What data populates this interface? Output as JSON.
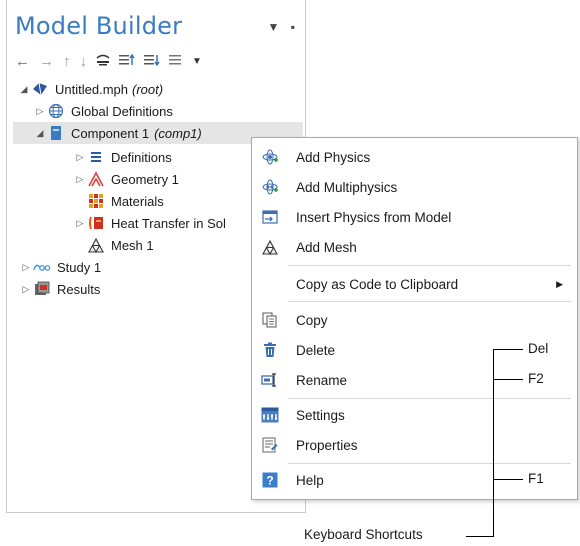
{
  "panel": {
    "title": "Model Builder",
    "header_controls": [
      "▾",
      "⊥"
    ]
  },
  "toolbar": {
    "icons": [
      "left-arrow-icon",
      "right-arrow-icon",
      "up-arrow-icon",
      "down-arrow-icon",
      "show-icon",
      "collapse-icon",
      "expand-icon",
      "list-icon",
      "dropdown-icon"
    ]
  },
  "tree": {
    "root": {
      "label": "Untitled.mph",
      "tag": "(root)"
    },
    "global": {
      "label": "Global Definitions"
    },
    "component": {
      "label": "Component 1",
      "tag": "(comp1)"
    },
    "definitions": {
      "label": "Definitions"
    },
    "geometry": {
      "label": "Geometry 1"
    },
    "materials": {
      "label": "Materials"
    },
    "heat": {
      "label": "Heat Transfer in Sol"
    },
    "mesh": {
      "label": "Mesh 1"
    },
    "study": {
      "label": "Study 1"
    },
    "results": {
      "label": "Results"
    }
  },
  "context_menu": {
    "add_physics": "Add Physics",
    "add_multiphysics": "Add Multiphysics",
    "insert_physics": "Insert Physics from Model",
    "add_mesh": "Add Mesh",
    "copy_as_code": "Copy as Code to Clipboard",
    "copy": "Copy",
    "delete": "Delete",
    "rename": "Rename",
    "settings": "Settings",
    "properties": "Properties",
    "help": "Help"
  },
  "shortcuts": {
    "delete": "Del",
    "rename": "F2",
    "help": "F1",
    "label": "Keyboard Shortcuts"
  },
  "colors": {
    "title": "#3a7cc4",
    "selection": "#e5e5e5",
    "menu_border": "#a9a9a9"
  }
}
